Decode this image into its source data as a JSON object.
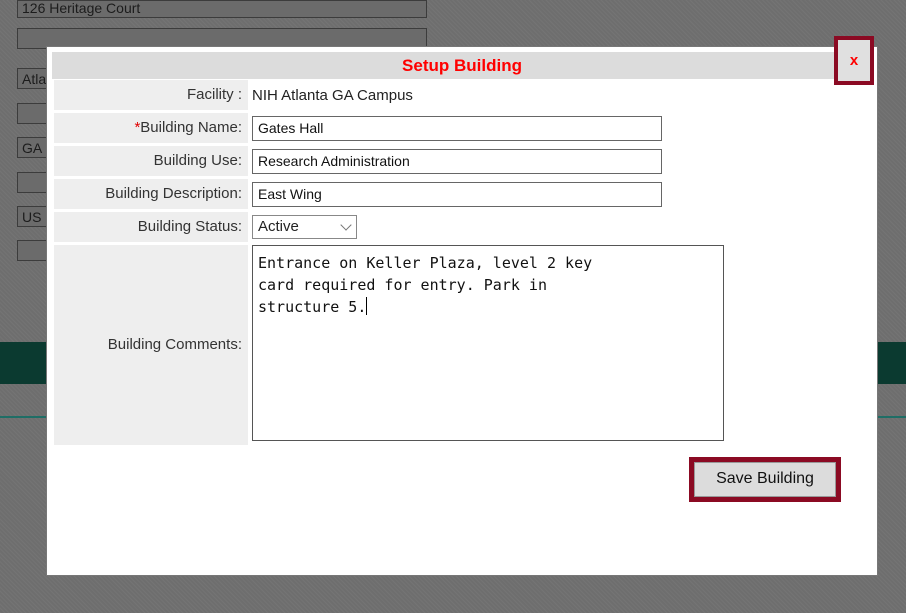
{
  "background": {
    "address_line": "126 Heritage Court",
    "city_value": "Atla",
    "state_value": "GA",
    "country_value": "US"
  },
  "dialog": {
    "title": "Setup Building",
    "close_label": "x",
    "facility_label": "Facility :",
    "facility_value": "NIH Atlanta GA Campus",
    "required_marker": "*",
    "name_label": "Building Name:",
    "name_value": "Gates Hall",
    "use_label": "Building Use:",
    "use_value": "Research Administration",
    "description_label": "Building Description:",
    "description_value": "East Wing",
    "status_label": "Building Status:",
    "status_value": "Active",
    "comments_label": "Building Comments:",
    "comments_value": "Entrance on Keller Plaza, level 2 key\ncard required for entry. Park in\nstructure 5.",
    "save_label": "Save Building"
  },
  "colors": {
    "title_red": "#ff0000",
    "button_frame": "#8b0a23",
    "dim_background": "#6e6e6e"
  }
}
